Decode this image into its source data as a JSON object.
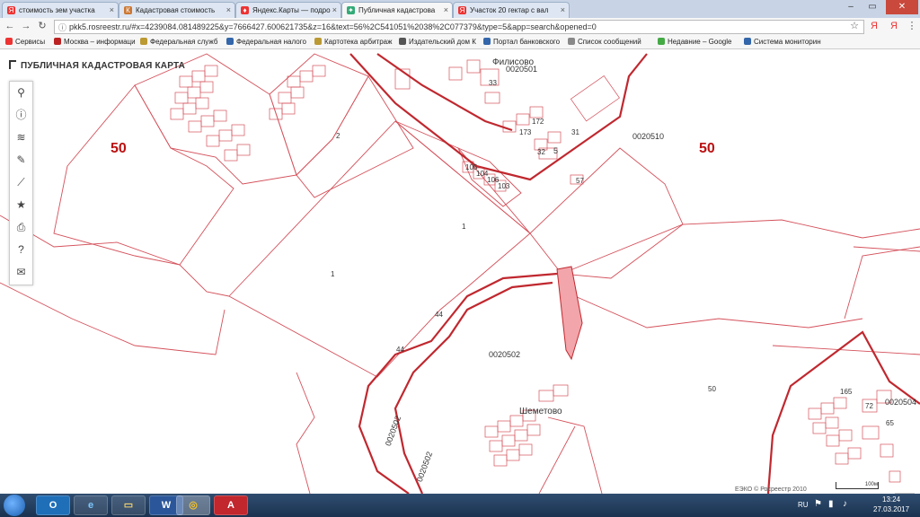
{
  "browser": {
    "tabs": [
      {
        "label": "стоимость зем участка",
        "fav_color": "#e33",
        "fav_glyph": "Я"
      },
      {
        "label": "Кадастровая стоимость",
        "fav_color": "#c73",
        "fav_glyph": "К"
      },
      {
        "label": "Яндекс.Карты — подро",
        "fav_color": "#e33",
        "fav_glyph": "♦"
      },
      {
        "label": "Публичная кадастрова",
        "fav_color": "#3a7",
        "fav_glyph": "✦"
      },
      {
        "label": "Участок 20 гектар с вал",
        "fav_color": "#e33",
        "fav_glyph": "Я"
      }
    ],
    "url": "pkk5.rosreestr.ru/#x=4239084.081489225&y=7666427.600621735&z=16&text=56%2C541051%2038%2C077379&type=5&app=search&opened=0",
    "bookmarks": [
      "Сервисы",
      "Москва – информаци",
      "Федеральная служб",
      "Федеральная налого",
      "Картотека арбитраж",
      "Издательский дом К",
      "Портал банковского",
      "Список сообщений",
      "Недавние – Google",
      "Система мониторин"
    ]
  },
  "map": {
    "title": "ПУБЛИЧНАЯ КАДАСТРОВАЯ КАРТА",
    "tools": [
      {
        "name": "search-icon",
        "glyph": "⚲"
      },
      {
        "name": "info-icon",
        "glyph": "ⓘ"
      },
      {
        "name": "layers-icon",
        "glyph": "≋"
      },
      {
        "name": "pencil-icon",
        "glyph": "✎"
      },
      {
        "name": "ruler-icon",
        "glyph": "⟋"
      },
      {
        "name": "star-icon",
        "glyph": "★"
      },
      {
        "name": "print-icon",
        "glyph": "⎙"
      },
      {
        "name": "help-icon",
        "glyph": "?"
      },
      {
        "name": "mail-icon",
        "glyph": "✉"
      }
    ],
    "district_labels": [
      "50",
      "50"
    ],
    "quarters": [
      "0020501",
      "0020510",
      "0020502",
      "0020502",
      "0020502",
      "0020504"
    ],
    "settlements": [
      "Филисово",
      "Шеметово"
    ],
    "parcels": [
      "2",
      "1",
      "1",
      "44",
      "44",
      "50",
      "5",
      "57",
      "31",
      "32",
      "33",
      "105",
      "104",
      "106",
      "103",
      "172",
      "173",
      "165",
      "65",
      "72"
    ],
    "copyright": "ЕЭКО © Росреестр 2010",
    "scale_label": "100м",
    "zoom_in": "+",
    "zoom_out": "−"
  },
  "taskbar": {
    "apps": [
      "O",
      "e",
      "▭",
      "W",
      "◎",
      "A"
    ],
    "lang": "RU",
    "time": "13:24",
    "date": "27.03.2017"
  },
  "colors": {
    "boundary": "#c0282f",
    "parcel_line": "#d4505a",
    "highlight": "#f2a5aa"
  }
}
